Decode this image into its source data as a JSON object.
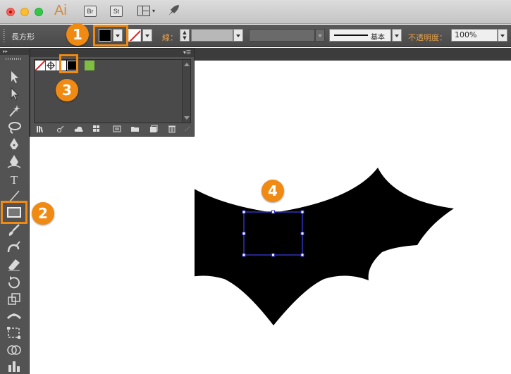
{
  "app": {
    "logo": "Ai",
    "bridge_label": "Br",
    "stock_label": "St"
  },
  "control_bar": {
    "selection_type": "長方形",
    "stroke_label": "線：",
    "brush_label": "基本",
    "opacity_label": "不透明度：",
    "opacity_value": "100%",
    "fill_color": "#000000"
  },
  "swatches": [
    {
      "name": "none",
      "color": "#ffffff"
    },
    {
      "name": "registration",
      "color": "#ffffff"
    },
    {
      "name": "white",
      "color": "#ffffff"
    },
    {
      "name": "black",
      "color": "#000000"
    },
    {
      "name": "green",
      "color": "#7fbf3f"
    }
  ],
  "callouts": {
    "one": "1",
    "two": "2",
    "three": "3",
    "four": "4",
    "color": "#f08a13"
  },
  "selection_box_color": "#3030c0"
}
